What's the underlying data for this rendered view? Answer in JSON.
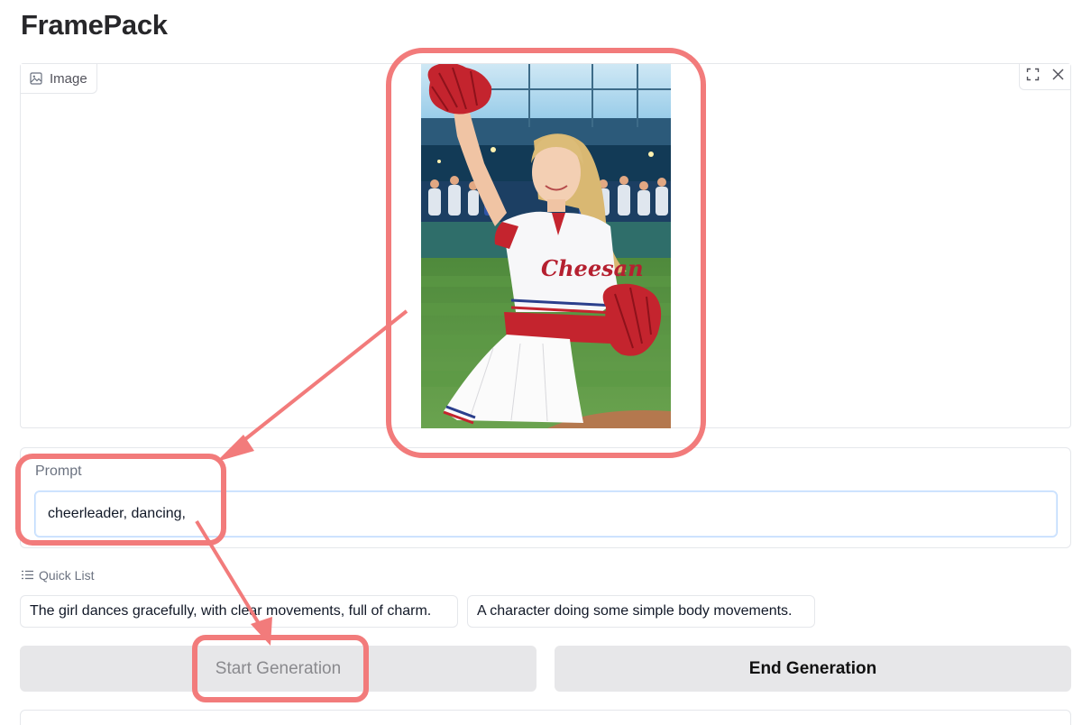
{
  "app": {
    "title": "FramePack"
  },
  "image_panel": {
    "label": "Image",
    "label_icon": "image-icon",
    "tools": {
      "fullscreen_icon": "fullscreen-icon",
      "close_icon": "close-icon"
    },
    "photo_jersey_text": "Cheesan"
  },
  "prompt": {
    "label": "Prompt",
    "value": "cheerleader, dancing,"
  },
  "quick_list": {
    "label": "Quick List",
    "icon": "list-icon",
    "items": [
      "The girl dances gracefully, with clear movements, full of charm.",
      "A character doing some simple body movements."
    ]
  },
  "buttons": {
    "start": "Start Generation",
    "end": "End Generation"
  },
  "colors": {
    "annotation": "#f27b7b",
    "input_border": "#bfdbfe",
    "button_bg": "#e7e7e9"
  }
}
